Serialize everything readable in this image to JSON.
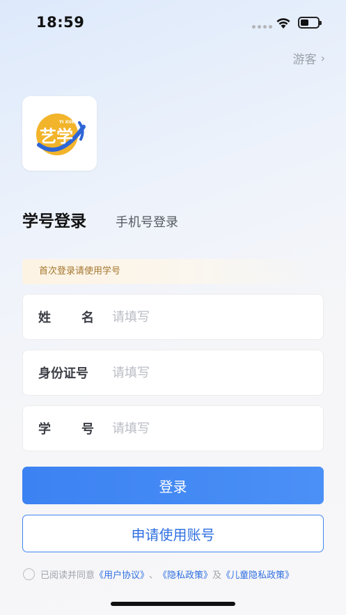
{
  "status_bar": {
    "time": "18:59"
  },
  "header": {
    "guest_label": "游客",
    "guest_chevron": "›"
  },
  "logo": {
    "brand_text": "艺学",
    "brand_subtext": "YI XUE",
    "colors": {
      "yellow": "#f2b42a",
      "blue": "#2f66d6"
    }
  },
  "tabs": {
    "active": "学号登录",
    "inactive": "手机号登录"
  },
  "notice": {
    "text": "首次登录请使用学号"
  },
  "form": {
    "name": {
      "label_chars": [
        "姓",
        "名"
      ],
      "placeholder": "请填写",
      "value": ""
    },
    "id_number": {
      "label": "身份证号",
      "placeholder": "请填写",
      "value": ""
    },
    "student_no": {
      "label_chars": [
        "学",
        "号"
      ],
      "placeholder": "请填写",
      "value": ""
    }
  },
  "buttons": {
    "login": "登录",
    "apply": "申请使用账号"
  },
  "agreement": {
    "prefix": "已阅读并同意",
    "user_agreement": "《用户协议》",
    "separator": "、",
    "privacy_policy": "《隐私政策》",
    "and": "及",
    "children_privacy": "《儿童隐私政策》",
    "checked": false
  },
  "colors": {
    "primary": "#3c82f2",
    "notice_text": "#a4762f",
    "link": "#2f6fe0"
  }
}
